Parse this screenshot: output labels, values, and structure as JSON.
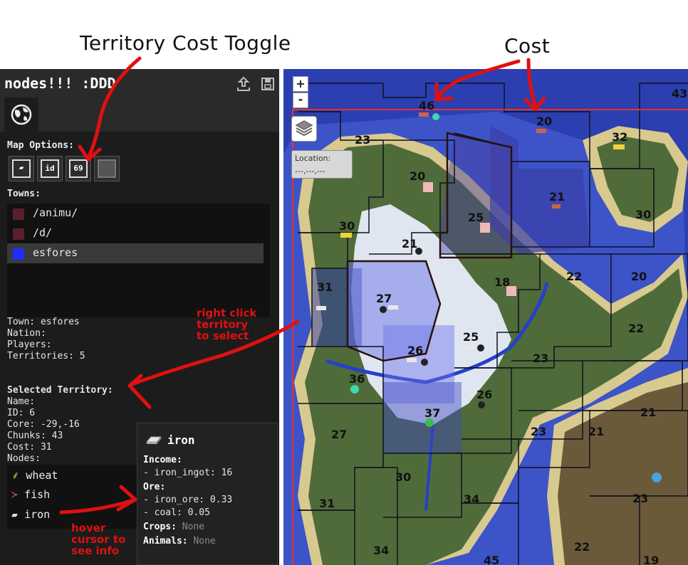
{
  "annotations": {
    "toggle_title": "Territory Cost Toggle",
    "cost_title": "Cost",
    "right_click_note": [
      "right click",
      "territory",
      "to select"
    ],
    "hover_note": [
      "hover",
      "cursor to",
      "see info"
    ]
  },
  "app": {
    "title": "nodes!!! :DDD",
    "map_options_label": "Map Options:",
    "options": [
      {
        "icon": "ingot-icon",
        "label": ""
      },
      {
        "icon": "id-icon",
        "label": "id"
      },
      {
        "icon": "cost-icon",
        "label": "69"
      },
      {
        "icon": "territory-icon",
        "label": ""
      }
    ],
    "towns_label": "Towns:",
    "towns": [
      {
        "name": "/animu/",
        "color": "#5a1f2c"
      },
      {
        "name": "/d/",
        "color": "#5a1f2c"
      },
      {
        "name": "esfores",
        "color": "#1f2eff",
        "selected": true
      }
    ]
  },
  "town_info": {
    "town": "Town: esfores",
    "nation": "Nation:",
    "players": "Players:",
    "territories": "Territories: 5"
  },
  "selected_territory": {
    "heading": "Selected Territory:",
    "name": "Name:",
    "id": "ID: 6",
    "core": "Core: -29,-16",
    "chunks": "Chunks: 43",
    "cost": "Cost: 31",
    "nodes_label": "Nodes:",
    "nodes": [
      "wheat",
      "fish",
      "iron"
    ]
  },
  "tooltip": {
    "title": "iron",
    "income_label": "Income:",
    "income": "- iron_ingot: 16",
    "ore_label": "Ore:",
    "ore": [
      "- iron_ore: 0.33",
      "- coal: 0.05"
    ],
    "crops_label": "Crops:",
    "crops_value": "None",
    "animals_label": "Animals:",
    "animals_value": "None"
  },
  "map": {
    "zoom_in": "+",
    "zoom_out": "-",
    "location_label": "Location:",
    "location_value": "---,---,---",
    "costs": [
      "43",
      "46",
      "20",
      "23",
      "32",
      "20",
      "21",
      "30",
      "30",
      "25",
      "21",
      "31",
      "27",
      "18",
      "22",
      "20",
      "25",
      "26",
      "22",
      "23",
      "36",
      "26",
      "37",
      "27",
      "23",
      "21",
      "21",
      "30",
      "34",
      "31",
      "23",
      "34",
      "45",
      "22",
      "19"
    ]
  }
}
